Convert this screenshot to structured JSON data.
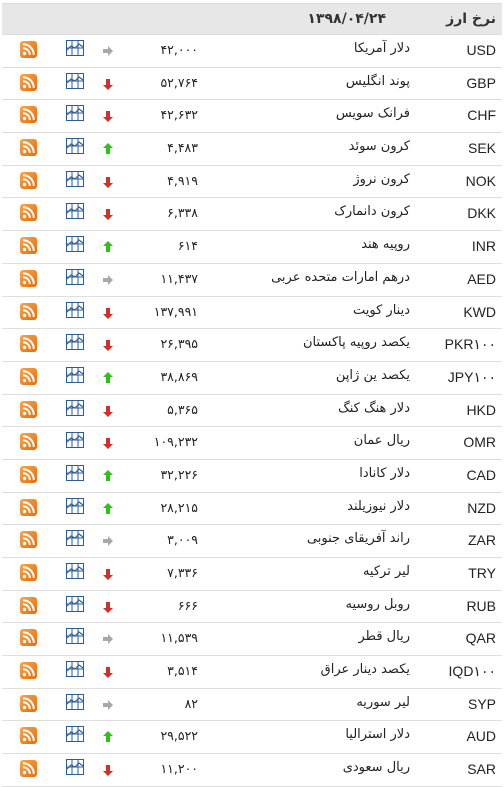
{
  "header": {
    "title": "نرخ ارز",
    "date": "۱۳۹۸/۰۴/۲۴"
  },
  "colors": {
    "up": "#2fc01a",
    "down": "#d0302a",
    "flat": "#a8a8a8",
    "rss": "#f18a25",
    "chart": "#2a5d9a",
    "header_bg": "#e7e7e7"
  },
  "rows": [
    {
      "code": "USD",
      "name": "دلار آمریکا",
      "price": "۴۲,۰۰۰",
      "trend": "flat"
    },
    {
      "code": "GBP",
      "name": "پوند انگلیس",
      "price": "۵۲,۷۶۴",
      "trend": "down"
    },
    {
      "code": "CHF",
      "name": "فرانک سویس",
      "price": "۴۲,۶۳۲",
      "trend": "down"
    },
    {
      "code": "SEK",
      "name": "کرون سوئد",
      "price": "۴,۴۸۳",
      "trend": "up"
    },
    {
      "code": "NOK",
      "name": "کرون نروژ",
      "price": "۴,۹۱۹",
      "trend": "down"
    },
    {
      "code": "DKK",
      "name": "کرون دانمارک",
      "price": "۶,۳۳۸",
      "trend": "down"
    },
    {
      "code": "INR",
      "name": "روپیه هند",
      "price": "۶۱۴",
      "trend": "up"
    },
    {
      "code": "AED",
      "name": "درهم امارات متحده عربی",
      "price": "۱۱,۴۳۷",
      "trend": "flat"
    },
    {
      "code": "KWD",
      "name": "دینار کویت",
      "price": "۱۳۷,۹۹۱",
      "trend": "down"
    },
    {
      "code": "PKR۱۰۰",
      "name": "یکصد روپیه پاکستان",
      "price": "۲۶,۳۹۵",
      "trend": "down"
    },
    {
      "code": "JPY۱۰۰",
      "name": "یکصد ین ژاپن",
      "price": "۳۸,۸۶۹",
      "trend": "up"
    },
    {
      "code": "HKD",
      "name": "دلار هنگ کنگ",
      "price": "۵,۳۶۵",
      "trend": "down"
    },
    {
      "code": "OMR",
      "name": "ریال عمان",
      "price": "۱۰۹,۲۳۲",
      "trend": "down"
    },
    {
      "code": "CAD",
      "name": "دلار کانادا",
      "price": "۳۲,۲۲۶",
      "trend": "up"
    },
    {
      "code": "NZD",
      "name": "دلار نیوزیلند",
      "price": "۲۸,۲۱۵",
      "trend": "up"
    },
    {
      "code": "ZAR",
      "name": "راند آفریقای جنوبی",
      "price": "۳,۰۰۹",
      "trend": "flat"
    },
    {
      "code": "TRY",
      "name": "لیر ترکیه",
      "price": "۷,۳۳۶",
      "trend": "down"
    },
    {
      "code": "RUB",
      "name": "روبل روسیه",
      "price": "۶۶۶",
      "trend": "down"
    },
    {
      "code": "QAR",
      "name": "ریال قطر",
      "price": "۱۱,۵۳۹",
      "trend": "flat"
    },
    {
      "code": "IQD۱۰۰",
      "name": "یکصد دینار عراق",
      "price": "۳,۵۱۴",
      "trend": "down"
    },
    {
      "code": "SYP",
      "name": "لیر سوریه",
      "price": "۸۲",
      "trend": "flat"
    },
    {
      "code": "AUD",
      "name": "دلار استرالیا",
      "price": "۲۹,۵۲۲",
      "trend": "up"
    },
    {
      "code": "SAR",
      "name": "ریال سعودی",
      "price": "۱۱,۲۰۰",
      "trend": "down"
    }
  ]
}
